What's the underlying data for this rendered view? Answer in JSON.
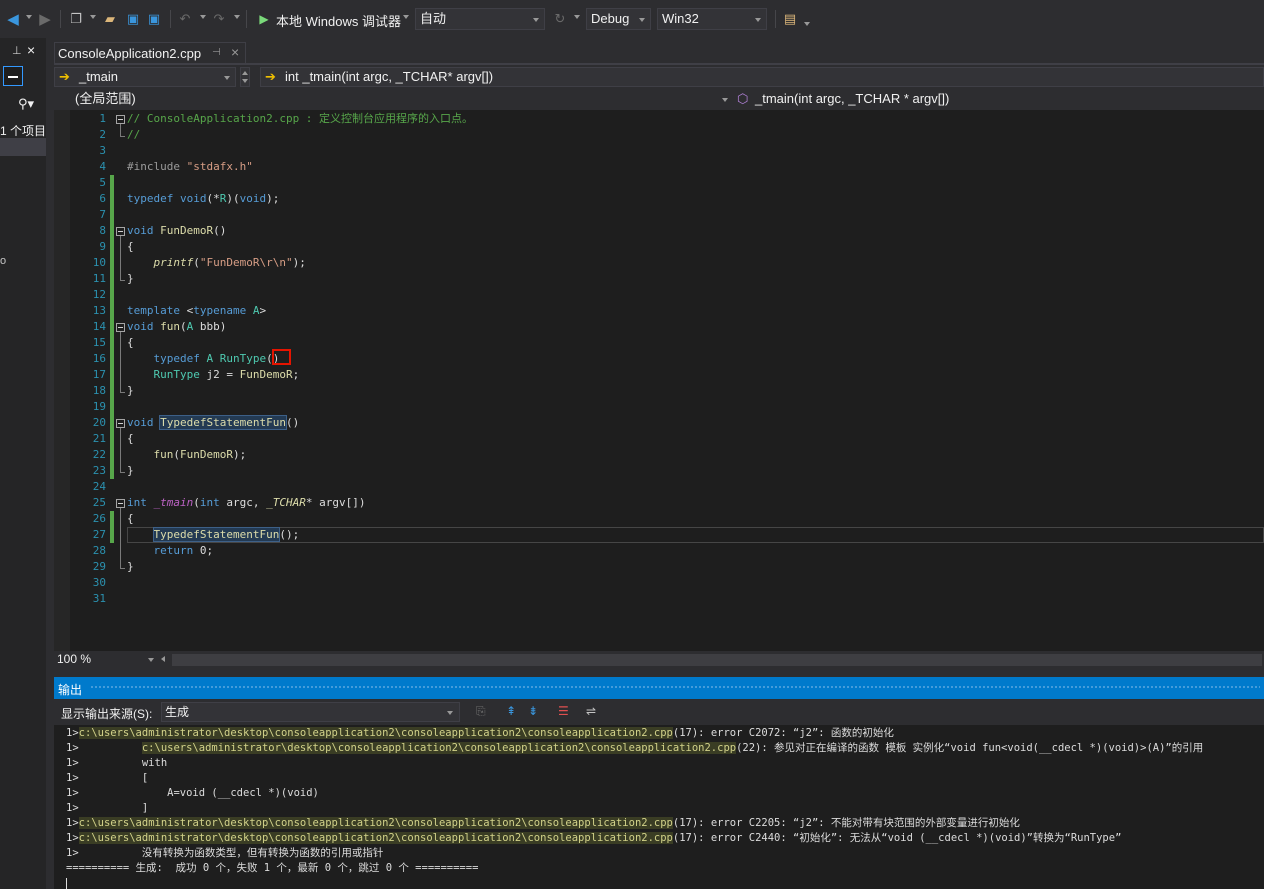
{
  "toolbar": {
    "run_label": "本地 Windows 调试器",
    "auto_label": "自动",
    "config": "Debug",
    "platform": "Win32"
  },
  "left_panel": {
    "items_label": "1 个项目",
    "dot_label": "o"
  },
  "tab": {
    "title": "ConsoleApplication2.cpp",
    "pin_glyph": "⊣",
    "close_glyph": "×"
  },
  "navigation": {
    "scope_left": "_tmain",
    "scope_right": "int _tmain(int argc, _TCHAR* argv[])",
    "global_scope": "(全局范围)",
    "member": "_tmain(int argc, _TCHAR * argv[])"
  },
  "editor": {
    "line_numbers": [
      "1",
      "2",
      "3",
      "4",
      "5",
      "6",
      "7",
      "8",
      "9",
      "10",
      "11",
      "12",
      "13",
      "14",
      "15",
      "16",
      "17",
      "18",
      "19",
      "20",
      "21",
      "22",
      "23",
      "24",
      "25",
      "26",
      "27",
      "28",
      "29",
      "30",
      "31"
    ],
    "lines": {
      "l1": "// ConsoleApplication2.cpp : 定义控制台应用程序的入口点。",
      "l2": "//",
      "l4_a": "#include ",
      "l4_b": "\"stdafx.h\"",
      "l6_a": "typedef",
      "l6_b": " ",
      "l6_c": "void",
      "l6_d": "(*",
      "l6_e": "R",
      "l6_f": ")(",
      "l6_g": "void",
      "l6_h": ");",
      "l8_a": "void",
      "l8_b": " ",
      "l8_c": "FunDemoR",
      "l8_d": "()",
      "l9": "{",
      "l10_a": "    ",
      "l10_b": "printf",
      "l10_c": "(",
      "l10_d": "\"FunDemoR\\r\\n\"",
      "l10_e": ");",
      "l11": "}",
      "l13_a": "template",
      "l13_b": " <",
      "l13_c": "typename",
      "l13_d": " ",
      "l13_e": "A",
      "l13_f": ">",
      "l14_a": "void",
      "l14_b": " ",
      "l14_c": "fun",
      "l14_d": "(",
      "l14_e": "A",
      "l14_f": " bbb)",
      "l15": "{",
      "l16_a": "    ",
      "l16_b": "typedef",
      "l16_c": " ",
      "l16_d": "A",
      "l16_e": " ",
      "l16_f": "RunType",
      "l16_g": "()",
      "l17_a": "    ",
      "l17_b": "RunType",
      "l17_c": " j2 = ",
      "l17_d": "FunDemoR",
      "l17_e": ";",
      "l18": "}",
      "l20_a": "void",
      "l20_b": " ",
      "l20_c": "TypedefStatementFun",
      "l20_d": "()",
      "l21": "{",
      "l22_a": "    ",
      "l22_b": "fun",
      "l22_c": "(",
      "l22_d": "FunDemoR",
      "l22_e": ");",
      "l23": "}",
      "l25_a": "int",
      "l25_b": " ",
      "l25_c": "_tmain",
      "l25_d": "(",
      "l25_e": "int",
      "l25_f": " argc, ",
      "l25_g": "_TCHAR",
      "l25_h": "* argv[])",
      "l26": "{",
      "l27_a": "    ",
      "l27_b": "TypedefStatementFun",
      "l27_c": "();",
      "l28_a": "    ",
      "l28_b": "return",
      "l28_c": " 0;",
      "l29": "}"
    }
  },
  "zoom": "100 %",
  "output": {
    "title": "输出",
    "source_label": "显示输出来源(S):",
    "source_value": "生成",
    "lines": {
      "o1_pre": "1>",
      "o1_path": "c:\\users\\administrator\\desktop\\consoleapplication2\\consoleapplication2\\consoleapplication2.cpp",
      "o1_msg": "(17): error C2072: “j2”: 函数的初始化",
      "o2_pre": "1>          ",
      "o2_path": "c:\\users\\administrator\\desktop\\consoleapplication2\\consoleapplication2\\consoleapplication2.cpp",
      "o2_msg": "(22): 参见对正在编译的函数 模板 实例化“void fun<void(__cdecl *)(void)>(A)”的引用",
      "o3": "1>          with",
      "o4": "1>          [",
      "o5": "1>              A=void (__cdecl *)(void)",
      "o6": "1>          ]",
      "o7_pre": "1>",
      "o7_path": "c:\\users\\administrator\\desktop\\consoleapplication2\\consoleapplication2\\consoleapplication2.cpp",
      "o7_msg": "(17): error C2205: “j2”: 不能对带有块范围的外部变量进行初始化",
      "o8_pre": "1>",
      "o8_path": "c:\\users\\administrator\\desktop\\consoleapplication2\\consoleapplication2\\consoleapplication2.cpp",
      "o8_msg": "(17): error C2440: “初始化”: 无法从“void (__cdecl *)(void)”转换为“RunType”",
      "o9": "1>          没有转换为函数类型，但有转换为函数的引用或指针",
      "o10": "========== 生成:  成功 0 个，失败 1 个，最新 0 个，跳过 0 个 =========="
    }
  },
  "colors": {
    "accent": "#007acc",
    "editor_bg": "#1e1e1e",
    "keyword": "#569cd6",
    "comment": "#57a64a",
    "string": "#d69d85",
    "function": "#dcdcaa",
    "type": "#4ec9b0",
    "macro": "#bd63c5",
    "error_box": "#e51400"
  }
}
